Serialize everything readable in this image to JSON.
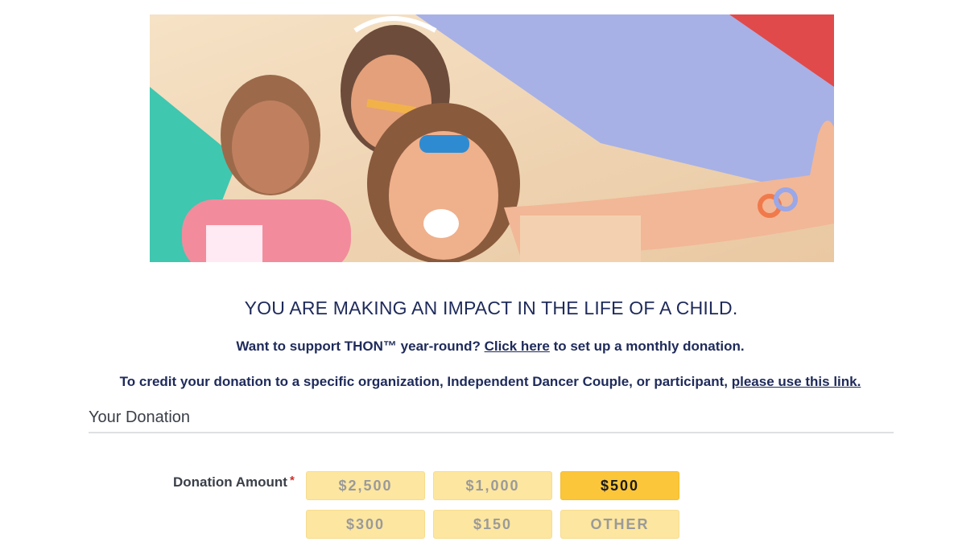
{
  "hero": {
    "image": "children-and-volunteer-under-parachute"
  },
  "headline": "YOU ARE MAKING AN IMPACT IN THE LIFE OF A CHILD.",
  "monthly": {
    "prefix": "Want to support THON™ year-round?",
    "link": "Click here",
    "suffix": "to set up a monthly donation."
  },
  "credit": {
    "prefix": "To credit your donation to a specific organization, Independent Dancer Couple, or participant,",
    "link": "please use this link."
  },
  "section_title": "Your Donation",
  "donation": {
    "label": "Donation Amount",
    "required_mark": "*",
    "selected": "$500",
    "options": [
      "$2,500",
      "$1,000",
      "$500",
      "$300",
      "$150",
      "OTHER"
    ]
  },
  "colors": {
    "navy": "#1e2a5a",
    "button": "#fde69f",
    "button_selected": "#fcc63a",
    "required": "#c8312b"
  }
}
